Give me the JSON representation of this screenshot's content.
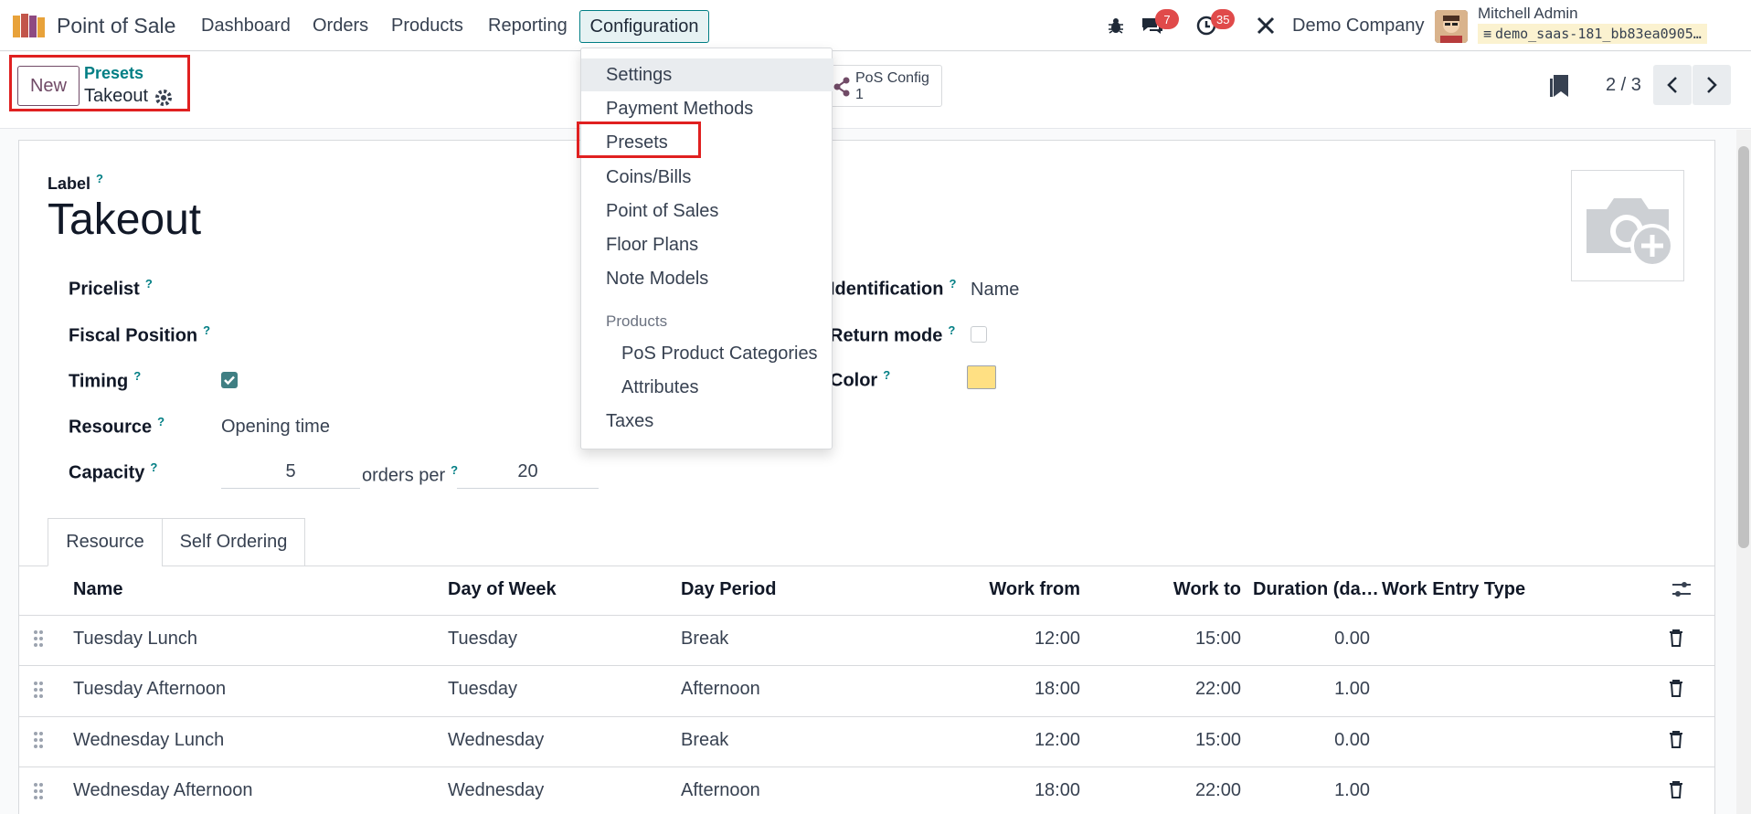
{
  "topbar": {
    "app_title": "Point of Sale",
    "menu": [
      "Dashboard",
      "Orders",
      "Products",
      "Reporting",
      "Configuration"
    ],
    "messages_count": "7",
    "activities_count": "35",
    "company": "Demo Company",
    "user_name": "Mitchell Admin",
    "db_name": "demo_saas-181_bb83ea0905…"
  },
  "control": {
    "new_label": "New",
    "breadcrumb_parent": "Presets",
    "breadcrumb_current": "Takeout",
    "smart_button_label": "PoS Config",
    "smart_button_value": "1",
    "pager": "2 / 3"
  },
  "dropdown": {
    "items": [
      "Settings",
      "Payment Methods",
      "Presets",
      "Coins/Bills",
      "Point of Sales",
      "Floor Plans",
      "Note Models"
    ],
    "section": "Products",
    "sub_items": [
      "PoS Product Categories",
      "Attributes"
    ],
    "last_item": "Taxes"
  },
  "form": {
    "label_field": "Label",
    "title": "Takeout",
    "pricelist_label": "Pricelist",
    "fiscal_position_label": "Fiscal Position",
    "timing_label": "Timing",
    "timing_checked": true,
    "resource_label": "Resource",
    "resource_value": "Opening time",
    "capacity_label": "Capacity",
    "capacity_value": "5",
    "orders_per_label": "orders per",
    "orders_per_value": "20",
    "identification_label": "Identification",
    "identification_value": "Name",
    "return_mode_label": "Return mode",
    "return_mode_checked": false,
    "color_label": "Color",
    "color_value": "#ffe083",
    "help_mark": "?"
  },
  "tabs": [
    "Resource",
    "Self Ordering"
  ],
  "table": {
    "headers": [
      "Name",
      "Day of Week",
      "Day Period",
      "Work from",
      "Work to",
      "Duration (da…",
      "Work Entry Type"
    ],
    "rows": [
      [
        "Tuesday Lunch",
        "Tuesday",
        "Break",
        "12:00",
        "15:00",
        "0.00",
        ""
      ],
      [
        "Tuesday Afternoon",
        "Tuesday",
        "Afternoon",
        "18:00",
        "22:00",
        "1.00",
        ""
      ],
      [
        "Wednesday Lunch",
        "Wednesday",
        "Break",
        "12:00",
        "15:00",
        "0.00",
        ""
      ],
      [
        "Wednesday Afternoon",
        "Wednesday",
        "Afternoon",
        "18:00",
        "22:00",
        "1.00",
        ""
      ]
    ]
  },
  "colors": {
    "accent": "#017e84",
    "brand": "#714b67",
    "highlight": "#e02020"
  }
}
